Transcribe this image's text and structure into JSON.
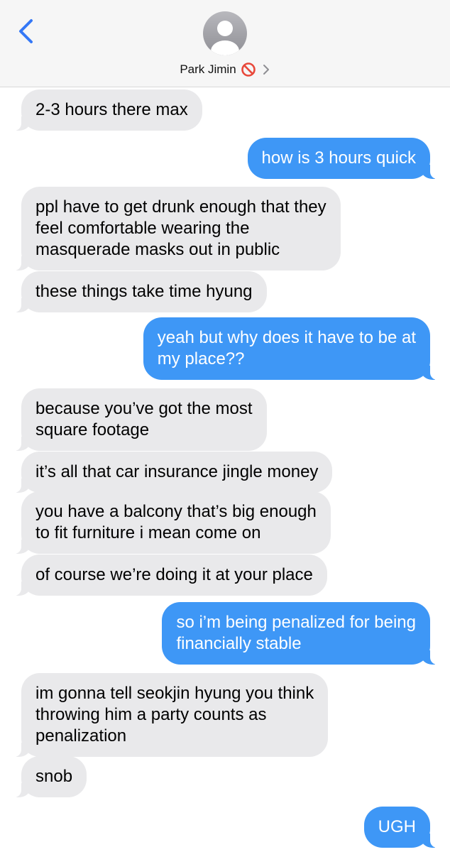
{
  "header": {
    "contact_name": "Park Jimin",
    "back_icon": "chevron-left-icon",
    "avatar_icon": "person-silhouette-icon",
    "blocked_icon": "no-entry-icon",
    "details_icon": "chevron-right-icon"
  },
  "colors": {
    "incoming_bubble": "#e9e9eb",
    "outgoing_bubble": "#3e97f6",
    "accent": "#3478f6",
    "blocked_red": "#e8483a"
  },
  "messages": [
    {
      "dir": "in",
      "text": "2-3 hours there max"
    },
    {
      "dir": "out",
      "text": "how is 3 hours quick"
    },
    {
      "dir": "in",
      "text": "ppl have to get drunk enough that they\nfeel comfortable wearing the\nmasquerade masks out in public"
    },
    {
      "dir": "in",
      "text": "these things take time hyung"
    },
    {
      "dir": "out",
      "text": "yeah but why does it have to be at\nmy place??"
    },
    {
      "dir": "in",
      "text": "because you’ve got the most\nsquare footage"
    },
    {
      "dir": "in",
      "text": "it’s all that car insurance jingle money"
    },
    {
      "dir": "in",
      "text": "you have a balcony that’s big enough\nto fit furniture i mean come on"
    },
    {
      "dir": "in",
      "text": "of course we’re doing it at your place"
    },
    {
      "dir": "out",
      "text": "so i’m being penalized for being\nfinancially stable"
    },
    {
      "dir": "in",
      "text": "im gonna tell seokjin hyung you think\nthrowing him a party counts as\npenalization"
    },
    {
      "dir": "in",
      "text": "snob"
    },
    {
      "dir": "out",
      "text": "UGH"
    }
  ]
}
